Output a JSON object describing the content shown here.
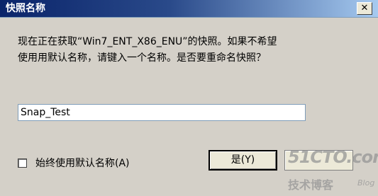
{
  "window": {
    "title": "快照名称",
    "close_label": "✕"
  },
  "dialog": {
    "message": "现在正在获取“Win7_ENT_X86_ENU”的快照。如果不希望\n使用用默认名称，请键入一个名称。是否要重命名快照？",
    "name_input_value": "Snap_Test",
    "checkbox_label": "始终使用默认名称(A)",
    "yes_button_label": "是(Y)"
  },
  "watermark": {
    "logo": "51CTO.com",
    "subtitle": "技术博客",
    "blog": "Blog"
  }
}
